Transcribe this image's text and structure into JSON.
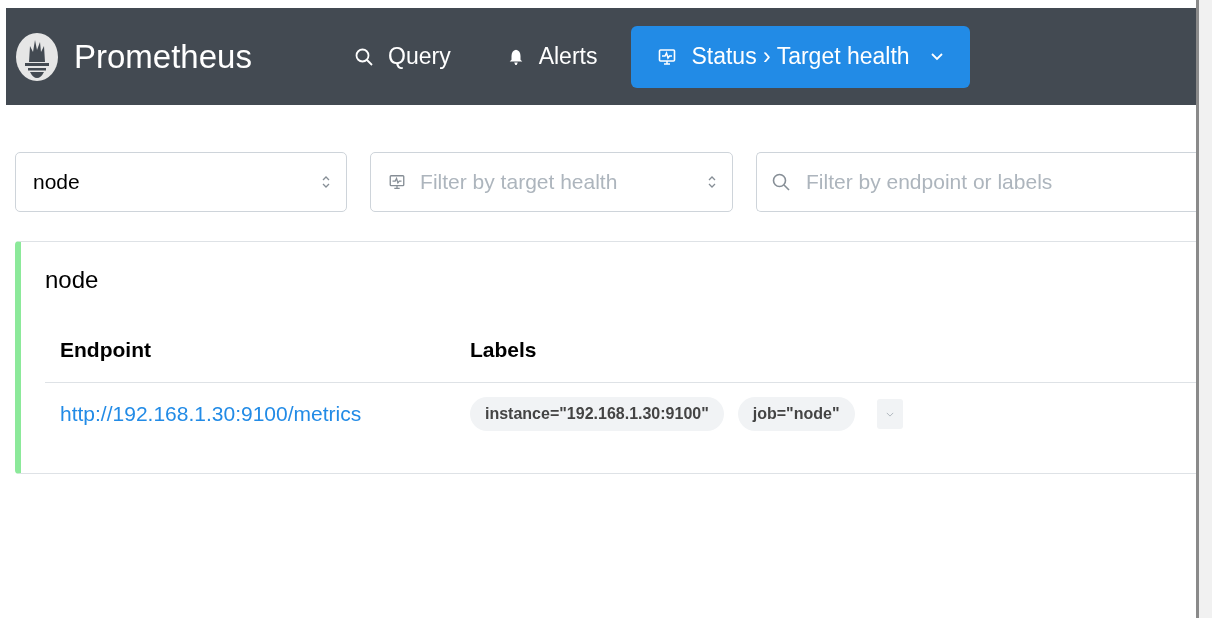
{
  "header": {
    "brand": "Prometheus",
    "nav": [
      {
        "kind": "search",
        "label": "Query",
        "selected": false
      },
      {
        "kind": "bell",
        "label": "Alerts",
        "selected": false
      },
      {
        "kind": "monitor",
        "label": "Status › Target health",
        "selected": true,
        "dropdown": true
      }
    ]
  },
  "filters": {
    "pool": {
      "value": "node"
    },
    "health": {
      "placeholder": "Filter by target health"
    },
    "search": {
      "placeholder": "Filter by endpoint or labels"
    }
  },
  "pool": {
    "name": "node",
    "healthy": true,
    "table": {
      "columns": [
        "Endpoint",
        "Labels"
      ],
      "rows": [
        {
          "endpoint": "http://192.168.1.30:9100/metrics",
          "labels": [
            "instance=\"192.168.1.30:9100\"",
            "job=\"node\""
          ]
        }
      ]
    }
  }
}
